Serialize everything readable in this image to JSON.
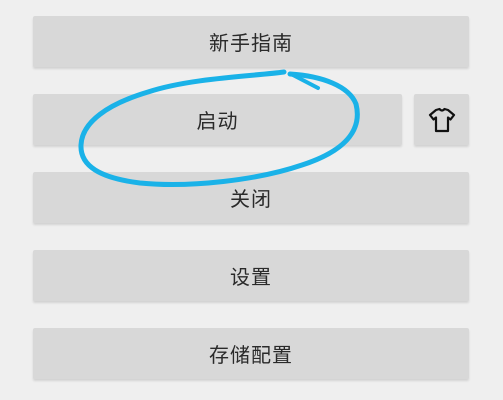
{
  "buttons": {
    "guide": "新手指南",
    "start": "启动",
    "close": "关闭",
    "settings": "设置",
    "save_config": "存储配置"
  },
  "icons": {
    "shirt": "shirt-icon"
  },
  "colors": {
    "background": "#efefef",
    "button": "#d8d8d8",
    "annotation": "#1ab2e8"
  }
}
